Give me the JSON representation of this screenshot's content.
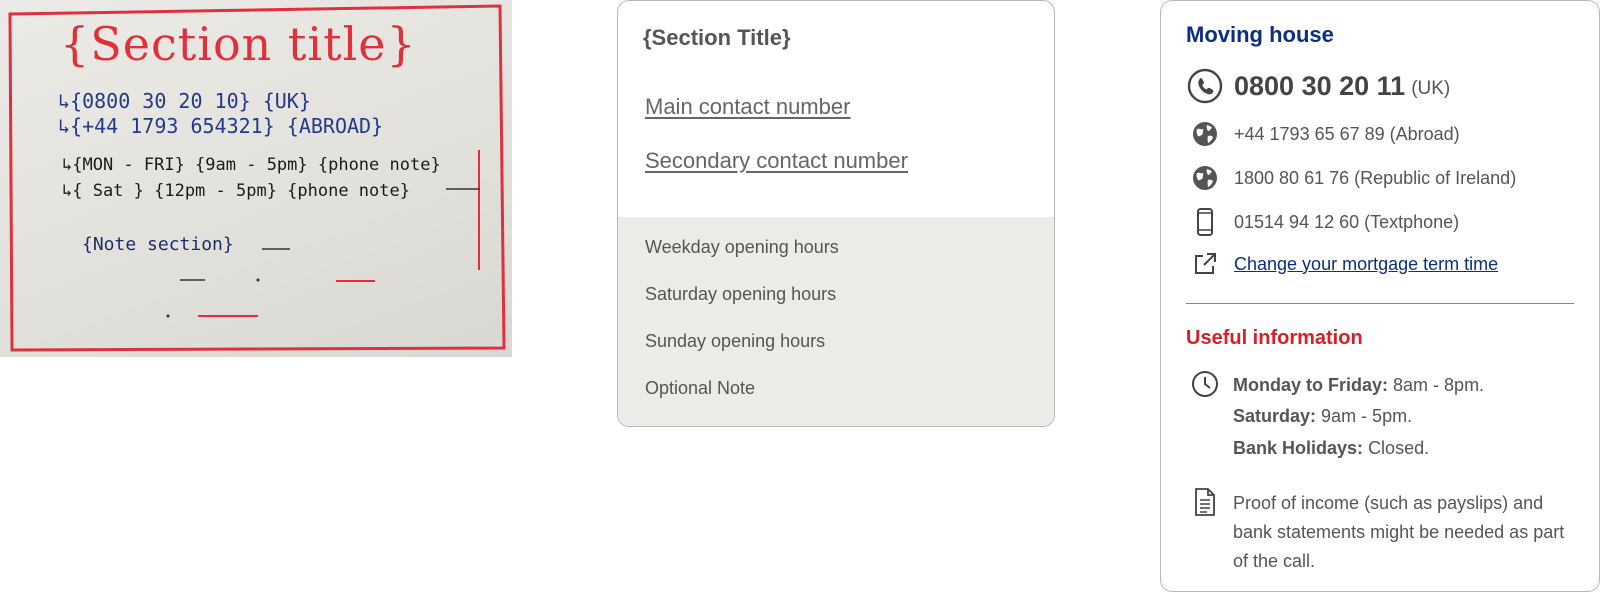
{
  "sketch": {
    "title": "{Section title}",
    "phone_1": "↳{0800 30 20 10} {UK}",
    "phone_2": "↳{+44 1793 654321} {ABROAD}",
    "hours_1": "↳{MON - FRI}  {9am - 5pm} {phone note}",
    "hours_2": "↳{ Sat }    {12pm - 5pm} {phone note}",
    "note": "{Note section}"
  },
  "wireframe": {
    "title": "{Section Title}",
    "main_contact": "Main contact number",
    "secondary_contact": "Secondary contact number",
    "hours": [
      "Weekday opening hours",
      "Saturday opening hours",
      "Sunday opening hours",
      "Optional Note"
    ]
  },
  "final": {
    "title": "Moving house",
    "main_phone": {
      "number": "0800 30 20 11",
      "suffix": "(UK)",
      "icon": "phone-icon"
    },
    "phones": [
      {
        "text": "+44 1793 65 67 89 (Abroad)",
        "icon": "globe-icon"
      },
      {
        "text": "1800 80 61 76 (Republic of Ireland)",
        "icon": "globe-icon"
      },
      {
        "text": "01514 94 12 60 (Textphone)",
        "icon": "mobile-icon"
      }
    ],
    "link": {
      "text": "Change your mortgage term time",
      "icon": "external-link-icon"
    },
    "useful_title": "Useful information",
    "hours": [
      {
        "label": "Monday to Friday:",
        "value": "8am - 8pm."
      },
      {
        "label": "Saturday:",
        "value": "9am - 5pm."
      },
      {
        "label": "Bank Holidays:",
        "value": "Closed."
      }
    ],
    "note": "Proof of income (such as payslips) and bank statements might be needed as part of the call.",
    "colors": {
      "brand_blue": "#0b2d82",
      "accent_red": "#d61f26"
    }
  }
}
